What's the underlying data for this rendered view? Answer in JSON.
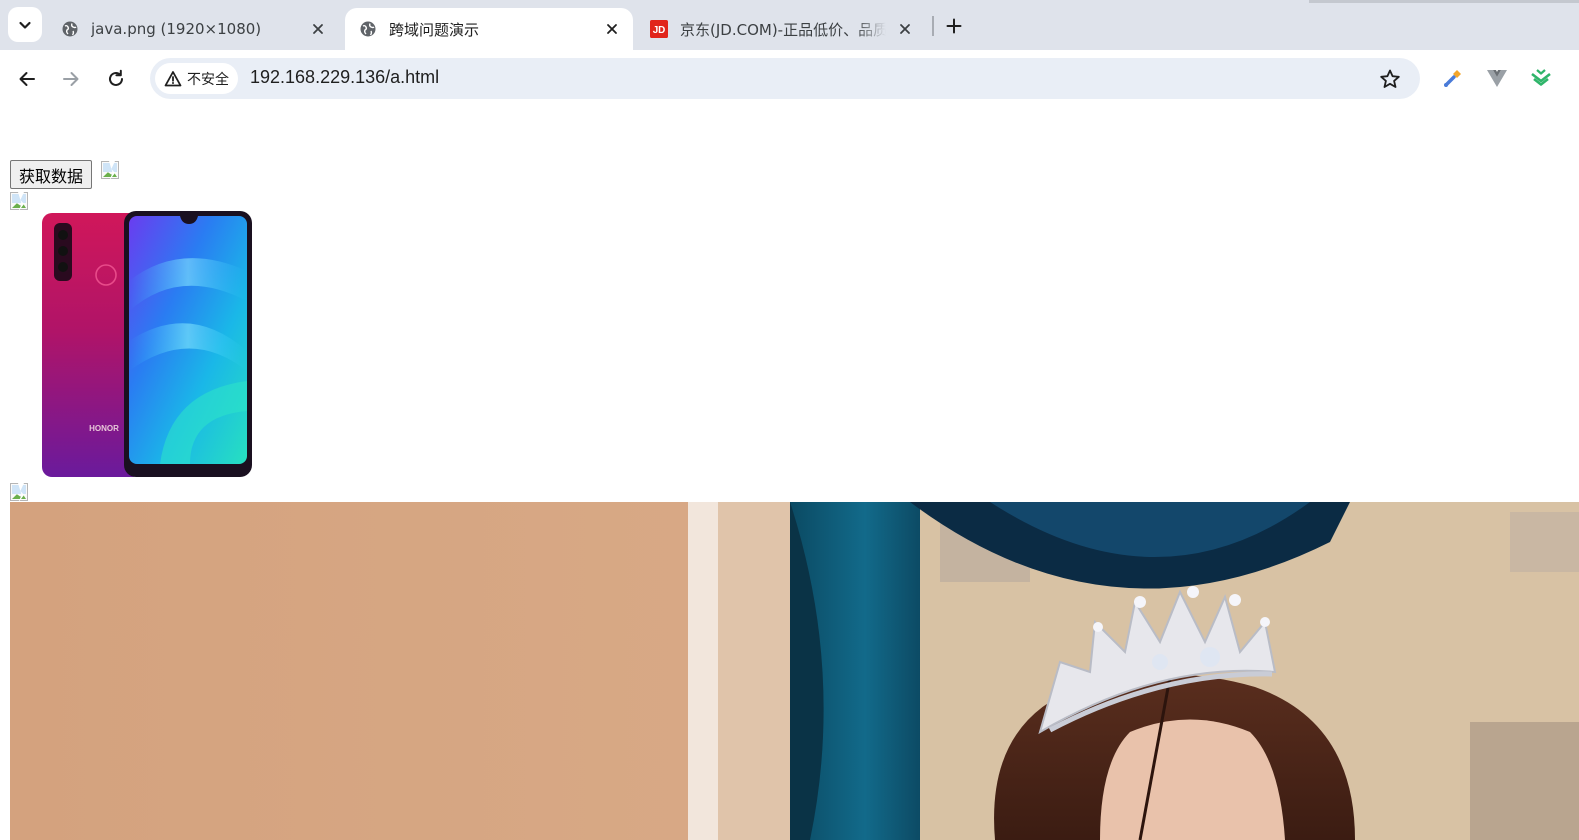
{
  "tabs": [
    {
      "title": "java.png (1920×1080)",
      "favicon": "globe-icon",
      "active": false
    },
    {
      "title": "跨域问题演示",
      "favicon": "globe-icon",
      "active": true
    },
    {
      "title": "京东(JD.COM)-正品低价、品质",
      "favicon": "jd-logo-icon",
      "active": false
    }
  ],
  "favicon_text": {
    "jd": "JD"
  },
  "omnibox": {
    "security_label": "不安全",
    "url": "192.168.229.136/a.html"
  },
  "page": {
    "fetch_button_label": "获取数据",
    "phone_brand_text": "HONOR"
  },
  "colors": {
    "tabstrip": "#dfe3eb",
    "omnibox": "#e9eef6",
    "jd_red": "#e1251b"
  }
}
